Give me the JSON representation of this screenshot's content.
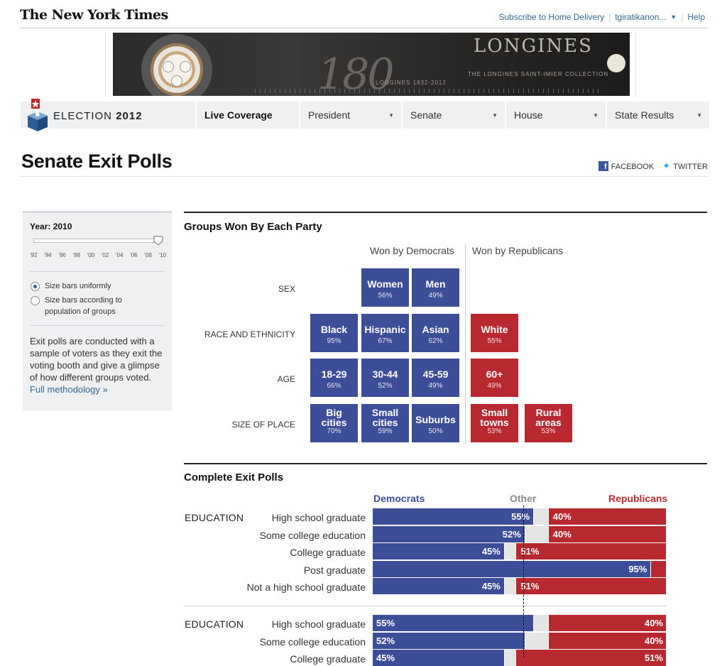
{
  "header": {
    "masthead": "The New York Times",
    "subscribe": "Subscribe to Home Delivery",
    "user": "tgiratikanon...",
    "help": "Help"
  },
  "ad": {
    "number": "180",
    "years": "LONGINES 1832-2012",
    "brand": "LONGINES",
    "tagline": "THE LONGINES SAINT-IMIER COLLECTION"
  },
  "election_nav": {
    "brand_light": "ELECTION",
    "brand_bold": "2012",
    "tabs": [
      {
        "label": "Live Coverage",
        "dropdown": false
      },
      {
        "label": "President",
        "dropdown": true
      },
      {
        "label": "Senate",
        "dropdown": true
      },
      {
        "label": "House",
        "dropdown": true
      },
      {
        "label": "State Results",
        "dropdown": true
      }
    ]
  },
  "page": {
    "title": "Senate Exit Polls",
    "facebook": "FACEBOOK",
    "twitter": "TWITTER"
  },
  "sidebar": {
    "year_label": "Year: 2010",
    "selected_year": "'10",
    "year_ticks": [
      "'92",
      "'94",
      "'96",
      "'98",
      "'00",
      "'02",
      "'04",
      "'06",
      "'08",
      "'10"
    ],
    "options": [
      {
        "label": "Size bars uniformly",
        "selected": true
      },
      {
        "label": "Size bars according to population of groups",
        "selected": false
      }
    ],
    "description": "Exit polls are conducted with a sample of voters as they exit the voting booth and give a glimpse of how different groups voted.",
    "methodology_link": "Full methodology »"
  },
  "groups": {
    "heading": "Groups Won By Each Party",
    "won_by_dem": "Won by Democrats",
    "won_by_rep": "Won by Republicans"
  },
  "exit_polls": {
    "heading": "Complete Exit Polls",
    "col_dem": "Democrats",
    "col_other": "Other",
    "col_rep": "Republicans"
  },
  "chart_data": [
    {
      "type": "table",
      "title": "Groups Won By Each Party",
      "rows": [
        {
          "label": "SEX",
          "groups": [
            {
              "name": "Women",
              "party": "Democrats",
              "value": 56
            },
            {
              "name": "Men",
              "party": "Democrats",
              "value": 49
            }
          ]
        },
        {
          "label": "RACE AND ETHNICITY",
          "groups": [
            {
              "name": "Black",
              "party": "Democrats",
              "value": 95
            },
            {
              "name": "Hispanic",
              "party": "Democrats",
              "value": 67
            },
            {
              "name": "Asian",
              "party": "Democrats",
              "value": 62
            },
            {
              "name": "White",
              "party": "Republicans",
              "value": 55
            }
          ]
        },
        {
          "label": "AGE",
          "groups": [
            {
              "name": "18-29",
              "party": "Democrats",
              "value": 66
            },
            {
              "name": "30-44",
              "party": "Democrats",
              "value": 52
            },
            {
              "name": "45-59",
              "party": "Democrats",
              "value": 49
            },
            {
              "name": "60+",
              "party": "Republicans",
              "value": 49
            }
          ]
        },
        {
          "label": "SIZE OF PLACE",
          "groups": [
            {
              "name": "Big cities",
              "party": "Democrats",
              "value": 70
            },
            {
              "name": "Small cities",
              "party": "Democrats",
              "value": 59
            },
            {
              "name": "Suburbs",
              "party": "Democrats",
              "value": 50
            },
            {
              "name": "Small towns",
              "party": "Republicans",
              "value": 53
            },
            {
              "name": "Rural areas",
              "party": "Republicans",
              "value": 53
            }
          ]
        }
      ],
      "colors": {
        "Democrats": "#3d4e99",
        "Republicans": "#b8292f"
      }
    },
    {
      "type": "bar",
      "title": "Complete Exit Polls",
      "stacked": true,
      "series_names": [
        "Democrats",
        "Other",
        "Republicans"
      ],
      "colors": {
        "Democrats": "#3d4e99",
        "Other": "#e5e5e5",
        "Republicans": "#b8292f"
      },
      "blocks": [
        {
          "category": "EDUCATION",
          "align": "center",
          "rows": [
            {
              "label": "High school graduate",
              "dem": 55,
              "other": 5,
              "rep": 40,
              "dem_label": "55%",
              "rep_label": "40%"
            },
            {
              "label": "Some college education",
              "dem": 52,
              "other": 8,
              "rep": 40,
              "dem_label": "52%",
              "rep_label": "40%"
            },
            {
              "label": "College graduate",
              "dem": 45,
              "other": 4,
              "rep": 51,
              "dem_label": "45%",
              "rep_label": "51%"
            },
            {
              "label": "Post graduate",
              "dem": 95,
              "other": 0,
              "rep": 5,
              "dem_label": "95%",
              "rep_label": ""
            },
            {
              "label": "Not a high school graduate",
              "dem": 45,
              "other": 4,
              "rep": 51,
              "dem_label": "45%",
              "rep_label": "51%"
            }
          ]
        },
        {
          "category": "EDUCATION",
          "align": "edge",
          "rows": [
            {
              "label": "High school graduate",
              "dem": 55,
              "other": 5,
              "rep": 40,
              "dem_label": "55%",
              "rep_label": "40%"
            },
            {
              "label": "Some college education",
              "dem": 52,
              "other": 8,
              "rep": 40,
              "dem_label": "52%",
              "rep_label": "40%"
            },
            {
              "label": "College graduate",
              "dem": 45,
              "other": 4,
              "rep": 51,
              "dem_label": "45%",
              "rep_label": "51%"
            }
          ]
        }
      ]
    }
  ]
}
